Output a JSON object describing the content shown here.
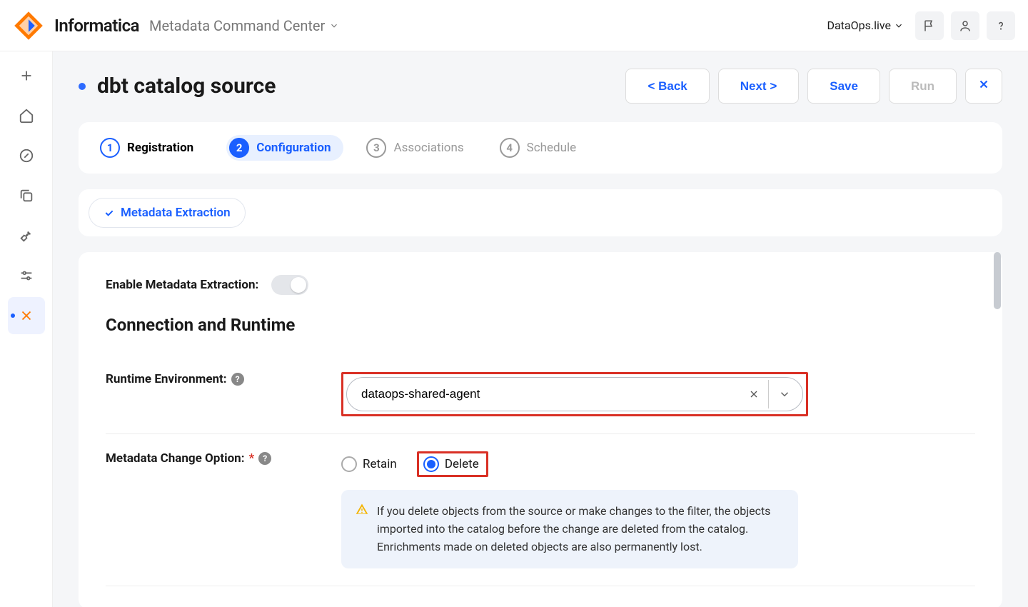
{
  "header": {
    "brand": "Informatica",
    "app": "Metadata Command Center",
    "org": "DataOps.live"
  },
  "page": {
    "title": "dbt catalog source",
    "buttons": {
      "back": "< Back",
      "next": "Next >",
      "save": "Save",
      "run": "Run"
    }
  },
  "stepper": {
    "steps": [
      {
        "num": "1",
        "label": "Registration"
      },
      {
        "num": "2",
        "label": "Configuration"
      },
      {
        "num": "3",
        "label": "Associations"
      },
      {
        "num": "4",
        "label": "Schedule"
      }
    ]
  },
  "subtab": {
    "label": "Metadata Extraction"
  },
  "form": {
    "enable_label": "Enable Metadata Extraction:",
    "section_title": "Connection and Runtime",
    "runtime_label": "Runtime Environment:",
    "runtime_value": "dataops-shared-agent",
    "change_label": "Metadata Change Option:",
    "radio_retain": "Retain",
    "radio_delete": "Delete",
    "warning_text": "If you delete objects from the source or make changes to the filter, the objects imported into the catalog before the change are deleted from the catalog. Enrichments made on deleted objects are also permanently lost."
  }
}
